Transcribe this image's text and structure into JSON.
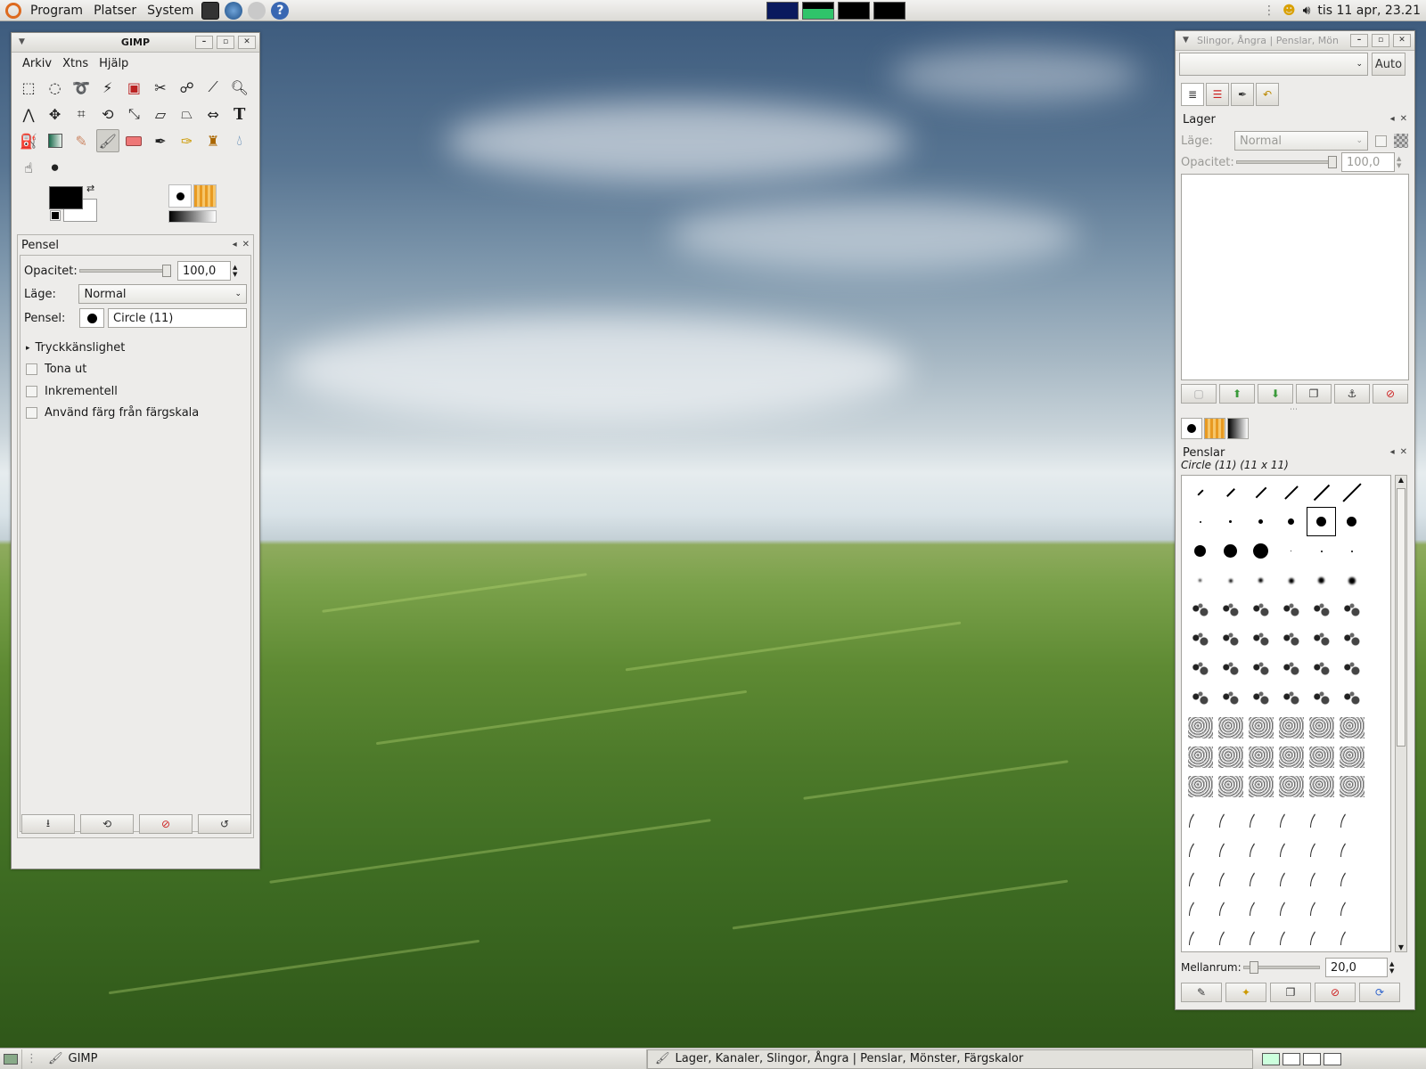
{
  "top_panel": {
    "menus": [
      "Program",
      "Platser",
      "System"
    ],
    "clock": "tis 11 apr, 23.21"
  },
  "toolbox": {
    "title": "GIMP",
    "menu": [
      "Arkiv",
      "Xtns",
      "Hjälp"
    ],
    "tools": [
      "rect-select",
      "ellipse-select",
      "free-select",
      "fuzzy-select",
      "color-select",
      "scissors",
      "foreground-select",
      "color-picker",
      "zoom",
      "measure",
      "move",
      "crop",
      "rotate",
      "scale",
      "shear",
      "perspective",
      "flip",
      "text",
      "bucket-fill",
      "blend",
      "pencil",
      "paintbrush",
      "eraser",
      "airbrush",
      "ink",
      "clone",
      "heal",
      "smudge",
      "dodge-burn"
    ],
    "selected_tool": "paintbrush"
  },
  "tool_options": {
    "title": "Pensel",
    "opacity_label": "Opacitet:",
    "opacity_value": "100,0",
    "opacity_level": 1.0,
    "mode_label": "Läge:",
    "mode_value": "Normal",
    "brush_label": "Pensel:",
    "brush_value": "Circle (11)",
    "pressure_label": "Tryckkänslighet",
    "fade_label": "Tona ut",
    "incremental_label": "Inkrementell",
    "gradient_color_label": "Använd färg från färgskala"
  },
  "dock": {
    "title": "Slingor, Ångra | Penslar, Mön",
    "auto_label": "Auto",
    "layers": {
      "title": "Lager",
      "mode_label": "Läge:",
      "mode_value": "Normal",
      "opacity_label": "Opacitet:",
      "opacity_value": "100,0",
      "opacity_level": 1.0
    },
    "brushes": {
      "title": "Penslar",
      "selected": "Circle (11) (11 x 11)",
      "spacing_label": "Mellanrum:",
      "spacing_value": "20,0",
      "spacing_level": 0.2
    }
  },
  "taskbar": {
    "tasks": [
      "GIMP",
      "Lager, Kanaler, Slingor, Ångra | Penslar, Mönster, Färgskalor"
    ]
  },
  "colors": {
    "panel": "#dcdbd6",
    "window": "#edecea",
    "accent": "#dd6a1f"
  }
}
